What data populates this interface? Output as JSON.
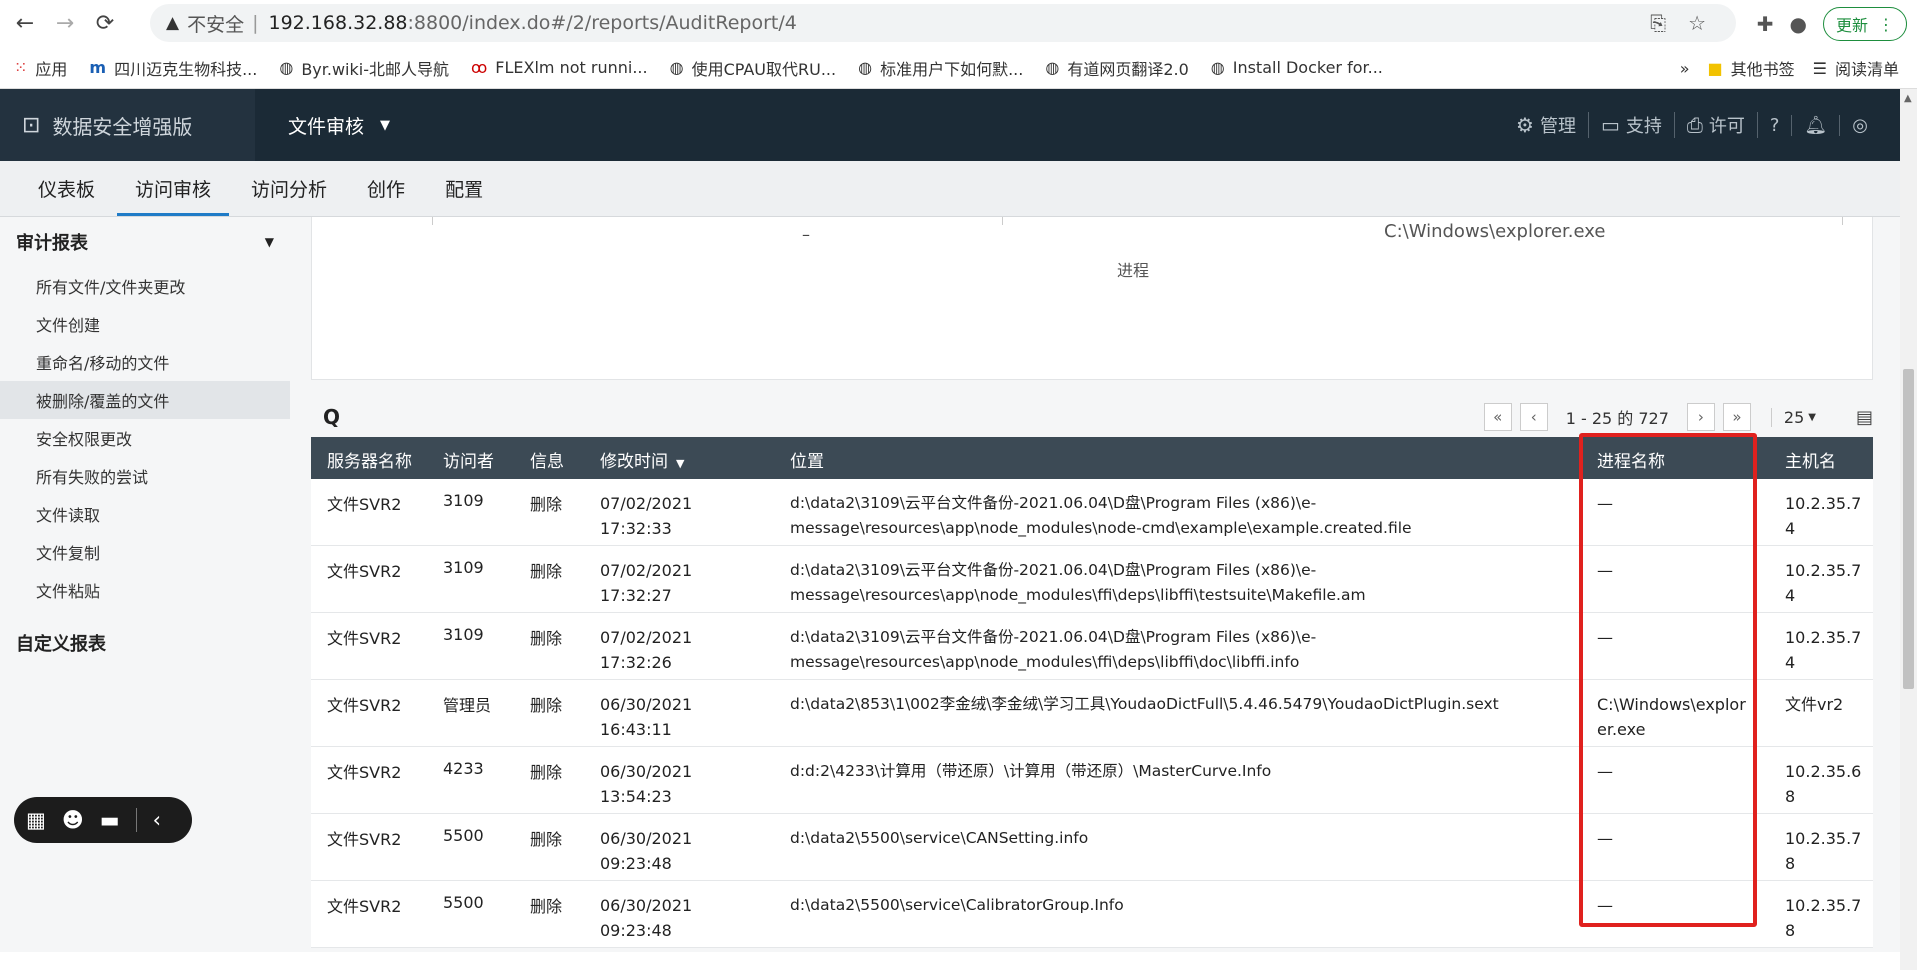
{
  "browser": {
    "insecure_label": "不安全",
    "url_host": "192.168.32.88",
    "url_path": ":8800/index.do#/2/reports/AuditReport/4",
    "update_label": "更新",
    "bookmarks": [
      "应用",
      "四川迈克生物科技...",
      "Byr.wiki-北邮人导航",
      "FLEXlm not runni...",
      "使用CPAU取代RU...",
      "标准用户下如何默...",
      "有道网页翻译2.0",
      "Install Docker for..."
    ],
    "bookmarks_more": "»",
    "other_bookmarks": "其他书签",
    "reading_list": "阅读清单"
  },
  "app": {
    "brand": "数据安全增强版",
    "module": "文件审核",
    "header_links": [
      "管理",
      "支持",
      "许可"
    ],
    "help_icon": "?"
  },
  "subnav": [
    "仪表板",
    "访问审核",
    "访问分析",
    "创作",
    "配置"
  ],
  "sidebar": {
    "section1": "审计报表",
    "items": [
      "所有文件/文件夹更改",
      "文件创建",
      "重命名/移动的文件",
      "被删除/覆盖的文件",
      "安全权限更改",
      "所有失败的尝试",
      "文件读取",
      "文件复制",
      "文件粘贴"
    ],
    "section2": "自定义报表"
  },
  "chart_panel": {
    "dash": "–",
    "exe_label": "C:\\Windows\\explorer.exe",
    "axis_label": "进程"
  },
  "pager": {
    "first": "«",
    "prev": "‹",
    "range": "1 - 25 的 727",
    "next": "›",
    "last": "»",
    "page_size": "25"
  },
  "table": {
    "columns": [
      "服务器名称",
      "访问者",
      "信息",
      "修改时间",
      "位置",
      "进程名称",
      "主机名"
    ],
    "rows": [
      {
        "server": "文件SVR2",
        "user": "3109",
        "info": "删除",
        "date": "07/02/2021",
        "time": "17:32:33",
        "location": "d:\\data2\\3109\\云平台文件备份-2021.06.04\\D盘\\Program Files (x86)\\e-message\\resources\\app\\node_modules\\node-cmd\\example\\example.created.file",
        "process": "—",
        "host": "10.2.35.74"
      },
      {
        "server": "文件SVR2",
        "user": "3109",
        "info": "删除",
        "date": "07/02/2021",
        "time": "17:32:27",
        "location": "d:\\data2\\3109\\云平台文件备份-2021.06.04\\D盘\\Program Files (x86)\\e-message\\resources\\app\\node_modules\\ffi\\deps\\libffi\\testsuite\\Makefile.am",
        "process": "—",
        "host": "10.2.35.74"
      },
      {
        "server": "文件SVR2",
        "user": "3109",
        "info": "删除",
        "date": "07/02/2021",
        "time": "17:32:26",
        "location": "d:\\data2\\3109\\云平台文件备份-2021.06.04\\D盘\\Program Files (x86)\\e-message\\resources\\app\\node_modules\\ffi\\deps\\libffi\\doc\\libffi.info",
        "process": "—",
        "host": "10.2.35.74"
      },
      {
        "server": "文件SVR2",
        "user": "管理员",
        "info": "删除",
        "date": "06/30/2021",
        "time": "16:43:11",
        "location": "d:\\data2\\853\\1\\002李金绒\\李金绒\\学习工具\\YoudaoDictFull\\5.4.46.5479\\YoudaoDictPlugin.sext",
        "process": "C:\\Windows\\explorer.exe",
        "host": "文件vr2"
      },
      {
        "server": "文件SVR2",
        "user": "4233",
        "info": "删除",
        "date": "06/30/2021",
        "time": "13:54:23",
        "location": "d:d:2\\4233\\计算用（带还原）\\计算用（带还原）\\MasterCurve.Info",
        "process": "—",
        "host": "10.2.35.68"
      },
      {
        "server": "文件SVR2",
        "user": "5500",
        "info": "删除",
        "date": "06/30/2021",
        "time": "09:23:48",
        "location": "d:\\data2\\5500\\service\\CANSetting.info",
        "process": "—",
        "host": "10.2.35.78"
      },
      {
        "server": "文件SVR2",
        "user": "5500",
        "info": "删除",
        "date": "06/30/2021",
        "time": "09:23:48",
        "location": "d:\\data2\\5500\\service\\CalibratorGroup.Info",
        "process": "—",
        "host": "10.2.35.78"
      }
    ]
  },
  "colors": {
    "header_bg": "#1b2a36",
    "grid_head_bg": "#3c4a55",
    "accent": "#1f7bc7",
    "highlight": "#e0211e"
  }
}
